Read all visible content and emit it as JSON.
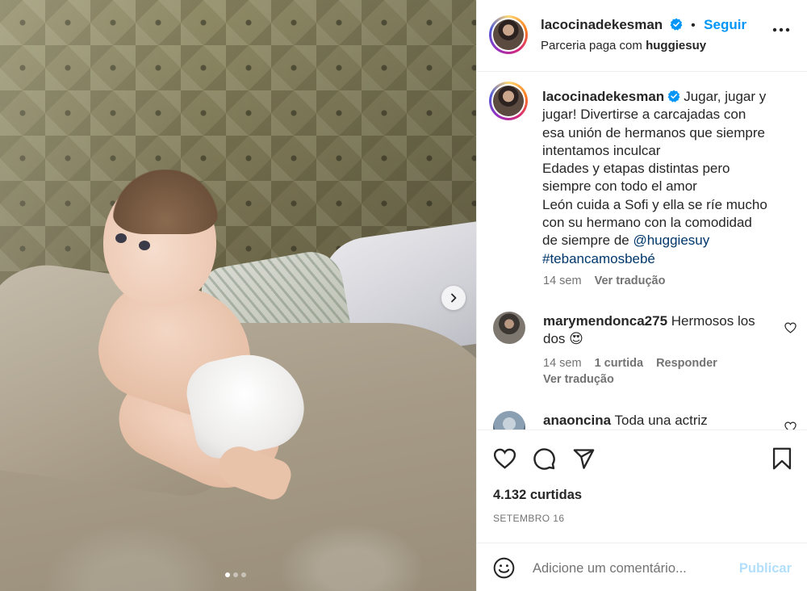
{
  "post": {
    "author": "lacocinadekesman",
    "follow_label": "Seguir",
    "partnership_prefix": "Parceria paga com",
    "partner": "huggiesuy",
    "caption_lines": [
      "Jugar, jugar y",
      "jugar! Divertirse a carcajadas con",
      "esa unión de hermanos que siempre",
      "intentamos inculcar",
      "Edades y etapas distintas pero",
      "siempre con todo el amor",
      "León cuida a Sofi y ella se ríe mucho",
      "con su hermano con la comodidad"
    ],
    "caption_tail_prefix": "de siempre de",
    "caption_mention": "@huggiesuy",
    "caption_hashtag": "#tebancamosbebé",
    "caption_time": "14 sem",
    "see_translation": "Ver tradução"
  },
  "comments": [
    {
      "user": "marymendonca275",
      "text_line1": "Hermosos los",
      "text_line2": "dos",
      "emoji": "😍",
      "time": "14 sem",
      "likes": "1 curtida",
      "reply": "Responder",
      "see_translation": "Ver tradução"
    },
    {
      "user": "anaoncina",
      "text_line1": "Toda una actriz"
    }
  ],
  "engagement": {
    "likes": "4.132 curtidas",
    "date": "SETEMBRO 16"
  },
  "composer": {
    "placeholder": "Adicione um comentário...",
    "publish": "Publicar"
  },
  "icons": {
    "verified": "verified-badge-icon",
    "more": "more-options-icon",
    "heart": "heart-icon",
    "comment": "comment-icon",
    "share": "share-icon",
    "save": "bookmark-icon",
    "emoji": "emoji-icon",
    "next": "chevron-right-icon"
  },
  "colors": {
    "accent": "#0095f6",
    "link": "#00376b",
    "publish_disabled": "#b2dffc",
    "muted": "#737373"
  },
  "carousel": {
    "slide_count": 3,
    "active_index": 0
  }
}
